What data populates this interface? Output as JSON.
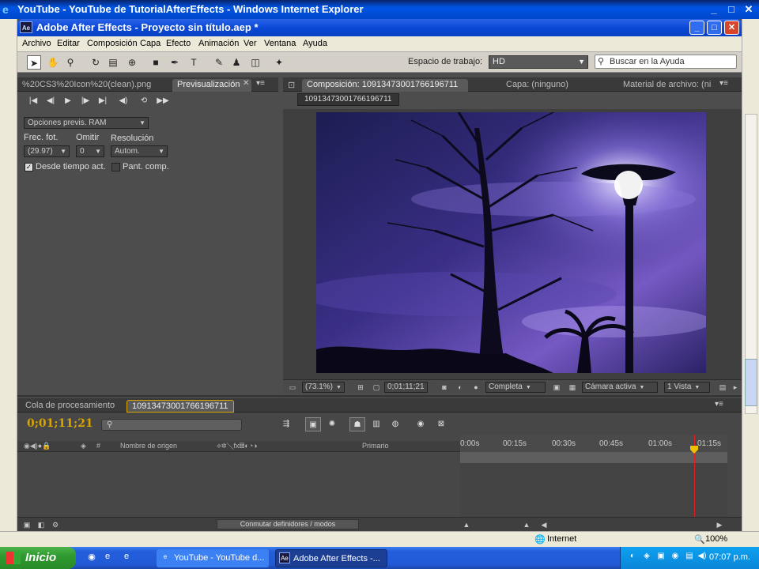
{
  "ie_window": {
    "title": "YouTube - YouTube de TutorialAfterEffects - Windows Internet Explorer"
  },
  "ae_window": {
    "title": "Adobe After Effects - Proyecto sin título.aep *"
  },
  "menu": [
    "Archivo",
    "Editar",
    "Composición",
    "Capa",
    "Efecto",
    "Animación",
    "Ver",
    "Ventana",
    "Ayuda"
  ],
  "toolbar": {
    "workspace_label": "Espacio de trabajo:",
    "workspace_value": "HD",
    "help_placeholder": "Buscar en la Ayuda"
  },
  "left_panel": {
    "tab_project": "%20CS3%20Icon%20(clean).png",
    "tab_preview": "Previsualización",
    "ram_options": "Opciones previs. RAM",
    "frame_rate_label": "Frec. fot.",
    "frame_rate_value": "(29.97)",
    "skip_label": "Omitir",
    "skip_value": "0",
    "resolution_label": "Resolución",
    "resolution_value": "Autom.",
    "from_current_label": "Desde tiempo act.",
    "full_screen_label": "Pant. comp."
  },
  "comp_panel": {
    "tab_comp": "Composición: 10913473001766196711",
    "tab_layer": "Capa: (ninguno)",
    "tab_footage": "Material de archivo: (ni",
    "comp_name": "10913473001766196711",
    "zoom": "(73.1%)",
    "timecode": "0;01;11;21",
    "resolution": "Completa",
    "camera": "Cámara activa",
    "views": "1 Vista"
  },
  "timeline": {
    "tab_render": "Cola de procesamiento",
    "tab_comp": "10913473001766196711",
    "current_time": "0;01;11;21",
    "col_source": "Nombre de origen",
    "col_parent": "Primario",
    "ruler_labels": [
      "0:00s",
      "00:15s",
      "00:30s",
      "00:45s",
      "01:00s",
      "01:15s"
    ],
    "modes_button": "Conmutar definidores / modos"
  },
  "statusbar": {
    "zone": "Internet",
    "zoom": "100%"
  },
  "taskbar": {
    "start": "Inicio",
    "task_ie": "YouTube - YouTube d...",
    "task_ae": "Adobe After Effects -...",
    "clock": "07:07 p.m."
  }
}
